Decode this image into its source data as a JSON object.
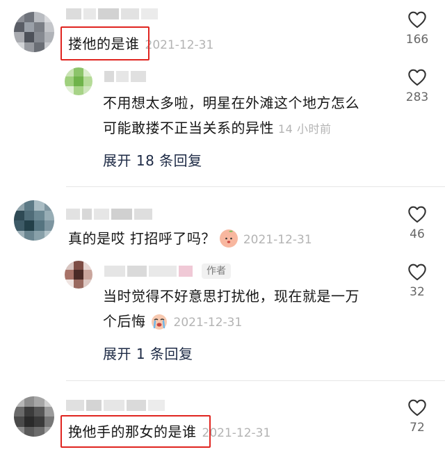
{
  "comments": [
    {
      "text": "搂他的是谁",
      "date": "2021-12-31",
      "likes": "166",
      "reply": {
        "text_line1": "不用想太多啦，明星在外滩这个地方怎么",
        "text_line2": "可能敢搂不正当关系的异性",
        "time": "14 小时前",
        "likes": "283"
      },
      "expand_label": "展开 18 条回复"
    },
    {
      "text": "真的是哎 打招呼了吗？",
      "date": "2021-12-31",
      "likes": "46",
      "reply": {
        "author_badge": "作者",
        "text_line1": "当时觉得不好意思打扰他，现在就是一万",
        "text_line2": "个后悔",
        "date": "2021-12-31",
        "likes": "32"
      },
      "expand_label": "展开 1 条回复"
    },
    {
      "text": "挽他手的那女的是谁",
      "date": "2021-12-31",
      "likes": "72"
    }
  ],
  "icons": {
    "like": "heart-outline-icon",
    "emoji_peach": "peach-emoji-icon",
    "emoji_cry": "crying-emoji-icon"
  },
  "colors": {
    "highlight_box": "#e0241f",
    "muted_text": "#b3b3b3",
    "link_text": "#1d2a45"
  }
}
